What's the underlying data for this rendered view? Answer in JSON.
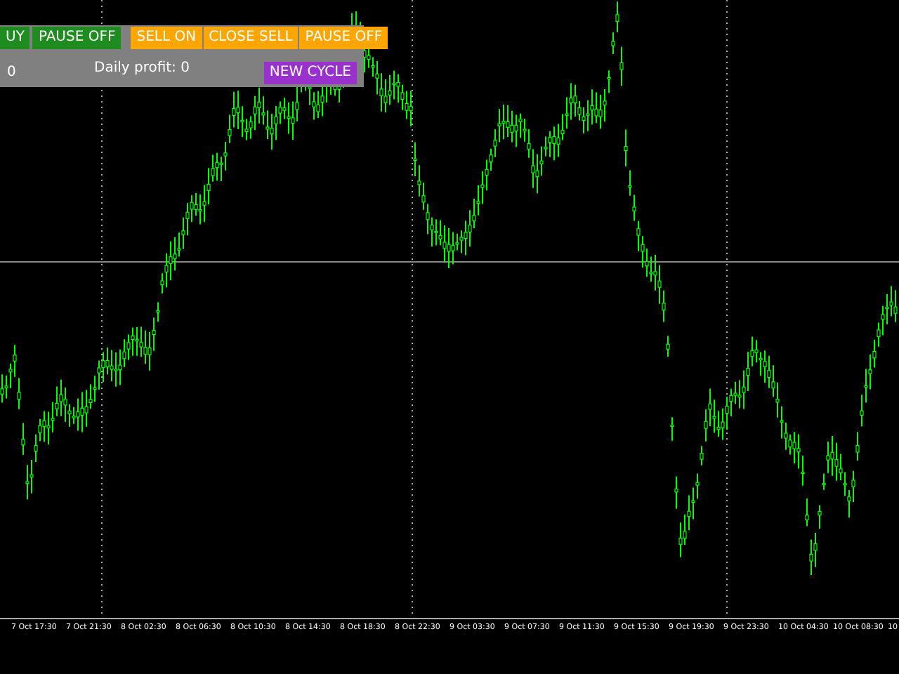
{
  "panel": {
    "rows": [
      {
        "kind": "buttons",
        "items": [
          {
            "kind": "button",
            "label": "UY",
            "color": "#1e8c1e"
          },
          {
            "kind": "button",
            "label": "PAUSE OFF",
            "color": "#1e8c1e"
          },
          {
            "kind": "button",
            "label": "SELL ON",
            "color": "#ffa500"
          },
          {
            "kind": "button",
            "label": "CLOSE SELL",
            "color": "#ffa500"
          },
          {
            "kind": "button",
            "label": "PAUSE OFF",
            "color": "#ffa500"
          }
        ]
      },
      {
        "kind": "info",
        "items": [
          {
            "kind": "text",
            "label": "0"
          },
          {
            "kind": "text",
            "label": "Daily profit: 0"
          },
          {
            "kind": "button",
            "label": "NEW CYCLE",
            "color": "#9932cc"
          }
        ]
      }
    ]
  },
  "time_axis": [
    "7 Oct 17:30",
    "7 Oct 21:30",
    "8 Oct 02:30",
    "8 Oct 06:30",
    "8 Oct 10:30",
    "8 Oct 14:30",
    "8 Oct 18:30",
    "8 Oct 22:30",
    "9 Oct 03:30",
    "9 Oct 07:30",
    "9 Oct 11:30",
    "9 Oct 15:30",
    "9 Oct 19:30",
    "9 Oct 23:30",
    "10 Oct 04:30",
    "10 Oct 08:30",
    "10"
  ]
}
